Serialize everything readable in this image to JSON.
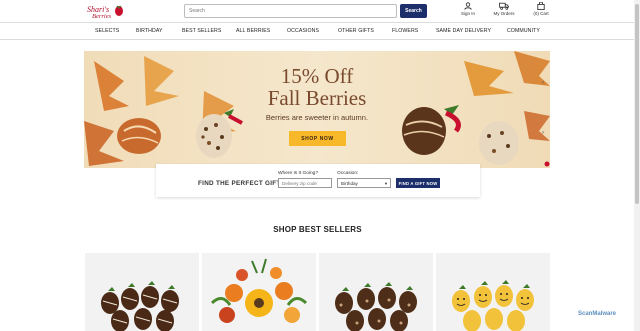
{
  "header": {
    "logo_text": "Shari's Berries",
    "search_placeholder": "Search",
    "search_button": "Search",
    "sign_in": "Sign In",
    "my_orders": "My Orders",
    "cart": "(0) Cart"
  },
  "nav": {
    "items": [
      "SELECTS",
      "BIRTHDAY",
      "BEST SELLERS",
      "ALL BERRIES",
      "OCCASIONS",
      "OTHER GIFTS",
      "FLOWERS",
      "SAME DAY DELIVERY",
      "COMMUNITY"
    ]
  },
  "hero": {
    "headline_1": "15% Off",
    "headline_2": "Fall Berries",
    "subhead": "Berries are sweeter in autumn.",
    "button": "SHOP NOW"
  },
  "finder": {
    "title": "FIND THE PERFECT GIFT",
    "zip_label": "Where Is It Going?",
    "zip_placeholder": "Delivery zip code",
    "occasion_label": "Occasion:",
    "occasion_value": "Birthday",
    "button": "FIND A GIFT NOW"
  },
  "section": {
    "best_sellers": "SHOP BEST SELLERS"
  },
  "watermark": "ScanMalware",
  "colors": {
    "brand_navy": "#1d2f6b",
    "cta_gold": "#f7b92a",
    "hero_bg": "#f3e2c4"
  }
}
